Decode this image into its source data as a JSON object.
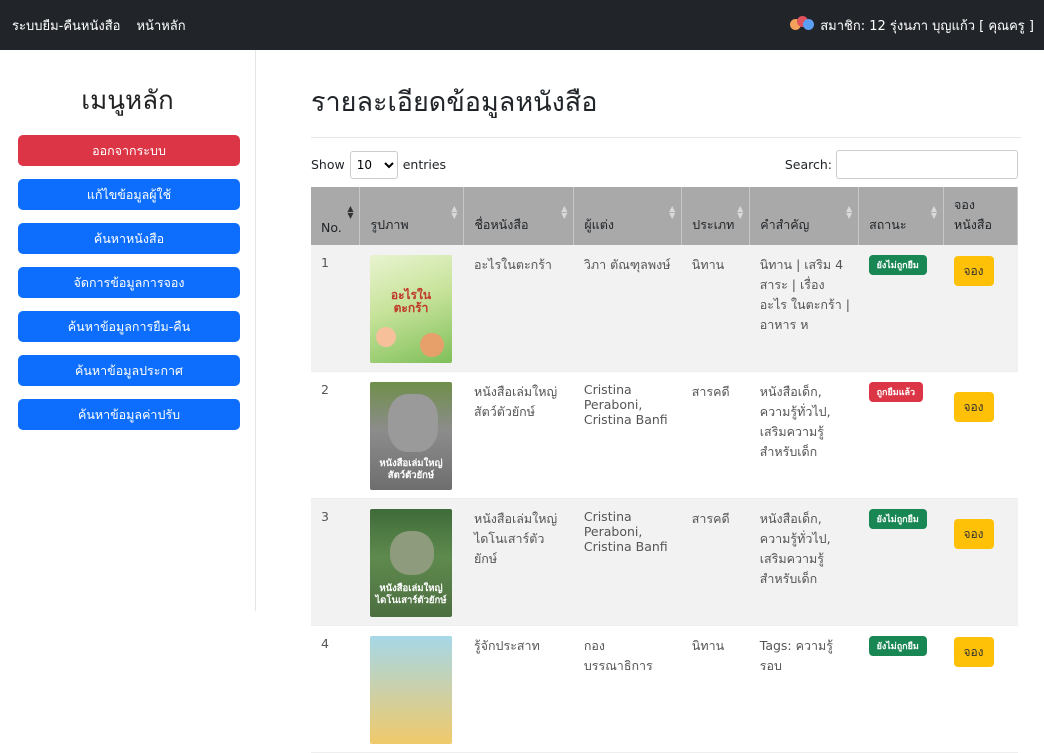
{
  "navbar": {
    "brand": "ระบบยืม-คืนหนังสือ",
    "home": "หน้าหลัก",
    "user": "สมาชิก: 12 รุ่งนภา บุญแก้ว [ คุณครู ]"
  },
  "sidebar": {
    "title": "เมนูหลัก",
    "buttons": [
      "ออกจากระบบ",
      "แก้ไขข้อมูลผู้ใช้",
      "ค้นหาหนังสือ",
      "จัดการข้อมูลการจอง",
      "ค้นหาข้อมูลการยืม-คืน",
      "ค้นหาข้อมูลประกาศ",
      "ค้นหาข้อมูลค่าปรับ"
    ]
  },
  "main": {
    "title": "รายละเอียดข้อมูลหนังสือ",
    "show_label": "Show",
    "entries_value": "10",
    "entries_label": "entries",
    "search_label": "Search:",
    "search_value": ""
  },
  "table": {
    "headers": [
      "No.",
      "รูปภาพ",
      "ชื่อหนังสือ",
      "ผู้แต่ง",
      "ประเภท",
      "คำสำคัญ",
      "สถานะ",
      "จอง\nหนังสือ"
    ],
    "rows": [
      {
        "no": "1",
        "title": "อะไรในตะกร้า",
        "author": "วิภา ตัณฑุลพงษ์",
        "type": "นิทาน",
        "keywords": "นิทาน | เสริม 4 สาระ | เรื่องอะไร ในตะกร้า | อาหาร ห",
        "status": "ยังไม่ถูกยืม",
        "action": "จอง",
        "cover_text": "อะไรใน ตะกร้า"
      },
      {
        "no": "2",
        "title": "หนังสือเล่มใหญ่ สัตว์ตัวยักษ์",
        "author": "Cristina Peraboni, Cristina Banfi",
        "type": "สารคดี",
        "keywords": "หนังสือเด็ก, ความรู้ทั่วไป, เสริมความรู้ สำหรับเด็ก",
        "status": "ถูกยืมแล้ว",
        "action": "จอง",
        "cover_text": "หนังสือเล่มใหญ่ สัตว์ตัวยักษ์"
      },
      {
        "no": "3",
        "title": "หนังสือเล่มใหญ่ ไดโนเสาร์ตัวยักษ์",
        "author": "Cristina Peraboni, Cristina Banfi",
        "type": "สารคดี",
        "keywords": "หนังสือเด็ก, ความรู้ทั่วไป, เสริมความรู้ สำหรับเด็ก",
        "status": "ยังไม่ถูกยืม",
        "action": "จอง",
        "cover_text": "หนังสือเล่มใหญ่ ไดโนเสาร์ตัวยักษ์"
      },
      {
        "no": "4",
        "title": "รู้จักประสาท",
        "author": "กองบรรณาธิการ",
        "type": "นิทาน",
        "keywords": "Tags: ความรู้รอบ",
        "status": "ยังไม่ถูกยืม",
        "action": "จอง",
        "cover_text": ""
      }
    ]
  },
  "colors": {
    "navbar": "#212529",
    "primary": "#0d6efd",
    "danger": "#dc3545",
    "warning": "#ffc107",
    "success": "#198754",
    "table_header": "#a9a9a9"
  }
}
